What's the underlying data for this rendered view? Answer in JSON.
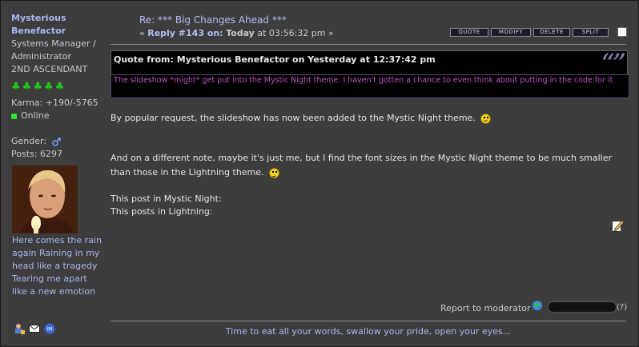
{
  "author": {
    "name": "Mysterious Benefactor",
    "title_line1": "Systems Manager /",
    "title_line2": "Administrator",
    "rank": "2ND ASCENDANT",
    "stars": [
      "♣",
      "♣",
      "♣",
      "♣",
      "♣"
    ],
    "karma": "Karma: +190/-5765",
    "status": "Online",
    "gender_label": "Gender:",
    "posts": "Posts: 6297",
    "personal_text": "Here comes the rain again Raining in my head like a tragedy Tearing me apart like a new emotion"
  },
  "post": {
    "subject": "Re: *** Big Changes Ahead ***",
    "reply_prefix": "« ",
    "reply_label": "Reply #143 on:",
    "reply_day": "Today",
    "reply_time": "at 03:56:32 pm »"
  },
  "actions": {
    "quote": "QUOTE",
    "modify": "MODIFY",
    "delete": "DELETE",
    "split": "SPLIT"
  },
  "quote": {
    "header": "Quote from: Mysterious Benefactor on Yesterday at 12:37:42 pm",
    "mark": "“”",
    "text": "The slideshow *might* get put into the Mystic Night theme. I haven't gotten a chance to even think about putting in the code for it"
  },
  "body": {
    "p1": "By popular request, the slideshow has now been added to the Mystic Night theme.",
    "p2": "And on a different note, maybe it's just me, but I find the font sizes in the Mystic Night theme to be much smaller than those in the Lightning theme.",
    "line3": "This post in Mystic Night:",
    "line4": "This posts in Lightning:"
  },
  "footer": {
    "report": "Report to moderator",
    "ip_help": "(?)",
    "signature": "Time to eat all your words, swallow your pride, open your eyes..."
  },
  "colors": {
    "background": "#3d3d3d",
    "link": "#b4bef0",
    "quote_text": "#c058c0",
    "stars": "#1ecb1e",
    "online": "#2ee22e"
  }
}
